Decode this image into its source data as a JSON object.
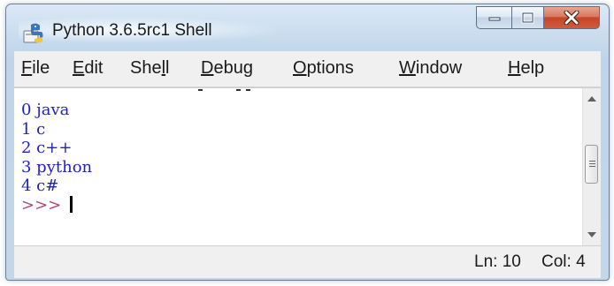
{
  "window": {
    "title": "Python 3.6.5rc1 Shell"
  },
  "menu": {
    "items": [
      {
        "first": "F",
        "rest": "ile"
      },
      {
        "first": "E",
        "rest": "dit"
      },
      {
        "pre": "She",
        "ul": "l",
        "post": "l"
      },
      {
        "first": "D",
        "rest": "ebug"
      },
      {
        "first": "O",
        "rest": "ptions"
      },
      {
        "first": "W",
        "rest": "indow"
      },
      {
        "first": "H",
        "rest": "elp"
      }
    ]
  },
  "shell": {
    "lines": [
      "0 java",
      "1 c",
      "2 c++",
      "3 python",
      "4 c#"
    ],
    "prompt": ">>>"
  },
  "status": {
    "line": "Ln: 10",
    "column": "Col: 4"
  },
  "icons": {
    "app": "python-idle-icon",
    "minimize": "minimize-icon",
    "maximize": "maximize-icon",
    "close": "close-icon"
  },
  "colors": {
    "output_text": "#1f1fc8",
    "prompt": "#b0407a",
    "close_button": "#c5462a"
  }
}
